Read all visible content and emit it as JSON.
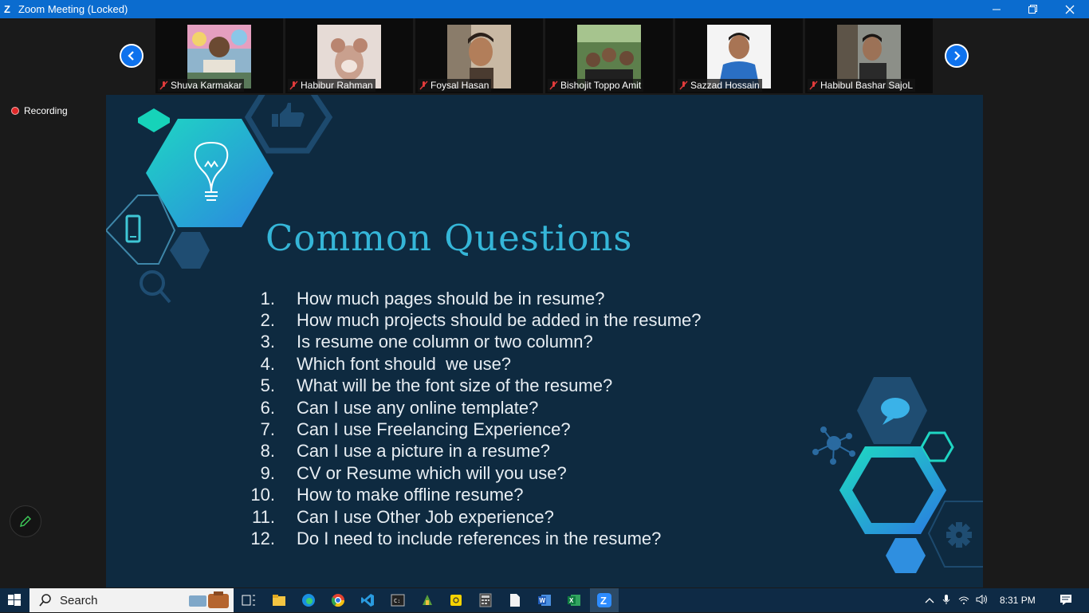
{
  "window": {
    "app_logo": "Z",
    "title": "Zoom Meeting (Locked)",
    "controls": [
      "minimize-icon",
      "restore-icon",
      "close-icon"
    ]
  },
  "gallery": {
    "participants": [
      {
        "name": "Shuva Karmakar",
        "muted": true
      },
      {
        "name": "Habibur Rahman",
        "muted": true
      },
      {
        "name": "Foysal Hasan",
        "muted": true
      },
      {
        "name": "Bishojit Toppo Amit",
        "muted": true
      },
      {
        "name": "Sazzad Hossain",
        "muted": true
      },
      {
        "name": "Habibul Bashar SajoL",
        "muted": true
      }
    ]
  },
  "recording": {
    "label": "Recording",
    "color": "#e02828"
  },
  "slide": {
    "title": "Common Questions",
    "questions": [
      {
        "num": "1.",
        "text": "How much pages should be in resume?"
      },
      {
        "num": "2.",
        "text": "How much projects should be added in the resume?"
      },
      {
        "num": "3.",
        "text": "Is resume one column or two column?"
      },
      {
        "num": "4.",
        "text": "Which font should  we use?"
      },
      {
        "num": "5.",
        "text": "What will be the font size of the resume?"
      },
      {
        "num": "6.",
        "text": "Can I use any online template?"
      },
      {
        "num": "7.",
        "text": "Can I use Freelancing Experience?"
      },
      {
        "num": "8.",
        "text": "Can I use a picture in a resume?"
      },
      {
        "num": "9.",
        "text": "CV or Resume which will you use?"
      },
      {
        "num": "10.",
        "text": "How to make offline resume?"
      },
      {
        "num": "11.",
        "text": "Can I use Other Job experience?"
      },
      {
        "num": "12.",
        "text": "Do I need to include references in the resume?"
      }
    ],
    "colors": {
      "background": "#0e2a40",
      "title": "#35b6d8",
      "accent_teal": "#1fd1c0",
      "accent_blue": "#2f8fe0"
    }
  },
  "taskbar": {
    "search_label": "Search",
    "apps": [
      "task-view-icon",
      "file-explorer-icon",
      "edge-icon",
      "chrome-icon",
      "vscode-icon",
      "terminal-icon",
      "app-icon",
      "sticky-notes-icon",
      "calculator-icon",
      "notepad-icon",
      "word-icon",
      "excel-icon",
      "zoom-icon"
    ],
    "time": "8:31 PM"
  }
}
